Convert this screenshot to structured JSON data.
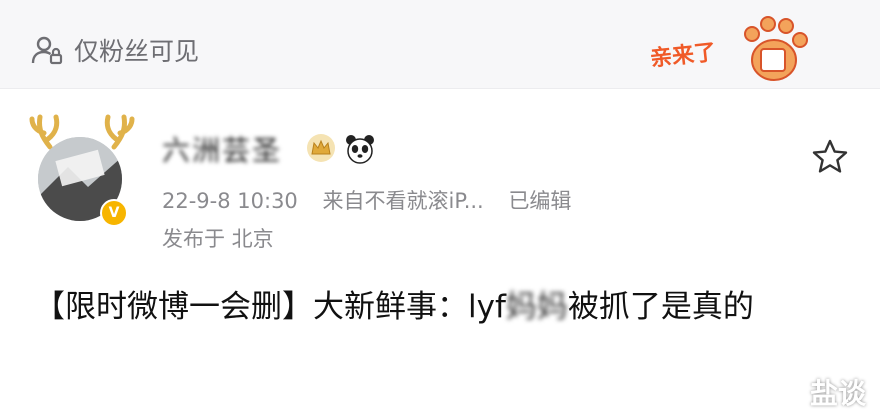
{
  "header": {
    "visibility_label": "仅粉丝可见",
    "sticker_text": "亲来了"
  },
  "post": {
    "author": {
      "name": "六洲芸圣",
      "avatar": "avatar-icon",
      "verified_badge": "V"
    },
    "meta": {
      "time": "22-9-8 10:30",
      "source": "来自不看就滚iP...",
      "edited": "已编辑"
    },
    "location": "发布于 北京",
    "text": {
      "part1": "【限时微博一会删】大新鲜事：lyf",
      "blurred": "妈妈",
      "part2": "被抓了是真的"
    }
  },
  "watermark": "盐谈",
  "colors": {
    "meta_gray": "#8a8a8e",
    "topbar_bg": "#f7f7f9",
    "text_dark": "#111111",
    "sticker_orange": "#f05a28"
  }
}
